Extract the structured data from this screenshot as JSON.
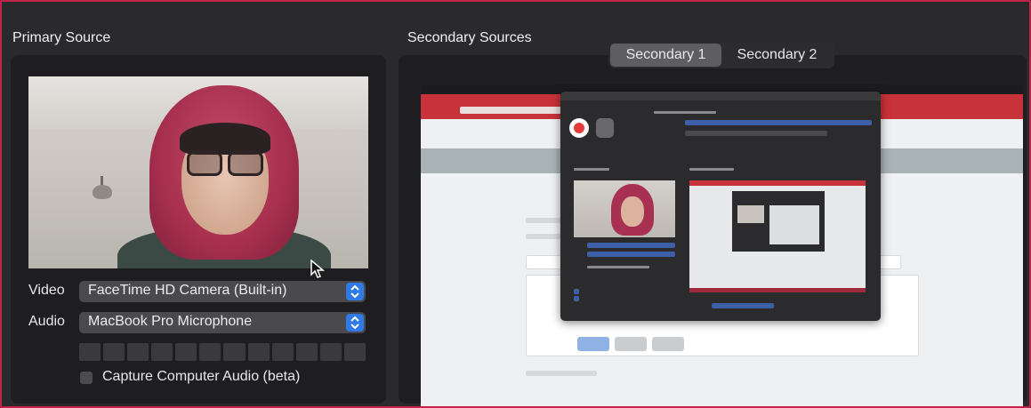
{
  "primary": {
    "heading": "Primary Source",
    "video_label": "Video",
    "video_value": "FaceTime HD Camera (Built-in)",
    "audio_label": "Audio",
    "audio_value": "MacBook Pro Microphone",
    "capture_audio_label": "Capture Computer Audio (beta)",
    "capture_audio_checked": false
  },
  "secondary": {
    "heading": "Secondary Sources",
    "tabs": [
      {
        "label": "Secondary 1",
        "active": true
      },
      {
        "label": "Secondary 2",
        "active": false
      }
    ]
  },
  "colors": {
    "accent": "#2f7ae6",
    "frame_border": "#c0234a",
    "record": "#e33b3b"
  }
}
